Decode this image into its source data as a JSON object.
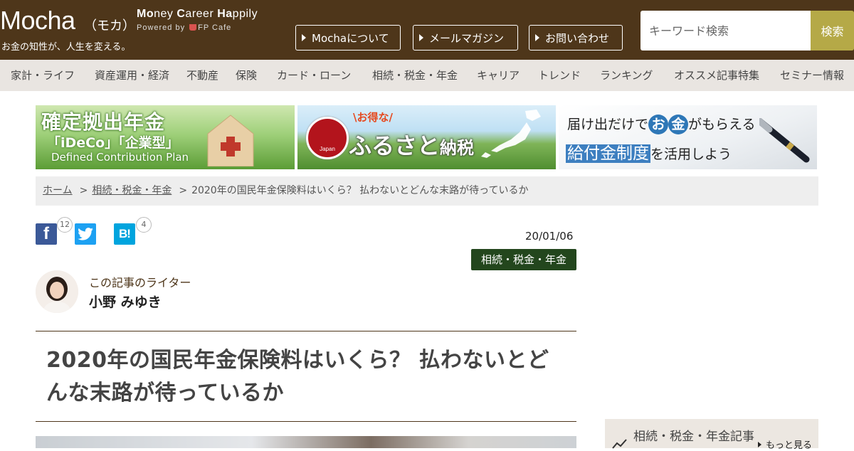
{
  "header": {
    "logo": "Mocha",
    "logo_kana": "（モカ）",
    "tagline_parts": [
      "Mo",
      "ney ",
      "C",
      "areer ",
      "Ha",
      "ppily"
    ],
    "powered_by": "Powered by",
    "powered_brand": "FP Cafe",
    "subcopy": "お金の知性が、人生を変える。",
    "buttons": [
      "Mochaについて",
      "メールマガジン",
      "お問い合わせ"
    ],
    "search_placeholder": "キーワード検索",
    "search_button": "検索"
  },
  "nav": [
    "家計・ライフ",
    "資産運用・経済",
    "不動産",
    "保険",
    "カード・ローン",
    "相続・税金・年金",
    "キャリア",
    "トレンド",
    "ランキング",
    "オススメ記事特集",
    "セミナー情報"
  ],
  "banners": {
    "ideco": {
      "title": "確定拠出年金",
      "sub": "「iDeCo」「企業型」",
      "en": "Defined Contribution Plan"
    },
    "furusato": {
      "otoku": "\\お得な/",
      "main": "ふるさと",
      "nouzei": "納税",
      "seal": "Japan"
    },
    "kyufukin": {
      "line1_pre": "届け出だけで",
      "circ1": "お",
      "circ2": "金",
      "line1_post": "がもらえる",
      "highlight": "給付金制度",
      "line2_post": "を活用しよう"
    }
  },
  "breadcrumb": {
    "home": "ホーム",
    "sep1": ">",
    "category": "相続・税金・年金",
    "sep2": ">",
    "current": "2020年の国民年金保険料はいくら？ 払わないとどんな末路が待っているか"
  },
  "social": {
    "facebook_count": "12",
    "hatena_count": "4",
    "fb_glyph": "f",
    "hb_glyph": "B!"
  },
  "article": {
    "date": "20/01/06",
    "category": "相続・税金・年金",
    "writer_label": "この記事のライター",
    "writer_name": "小野 みゆき",
    "title": "2020年の国民年金保険料はいくら？ 払わないとどんな末路が待っているか"
  },
  "sidebar": {
    "title": "相続・税金・年金記事",
    "more": "もっと見る"
  },
  "colors": {
    "header_bg": "#4e361a",
    "search_btn": "#b5a947",
    "badge": "#23461d",
    "nav_bg": "#e9e5e1"
  }
}
